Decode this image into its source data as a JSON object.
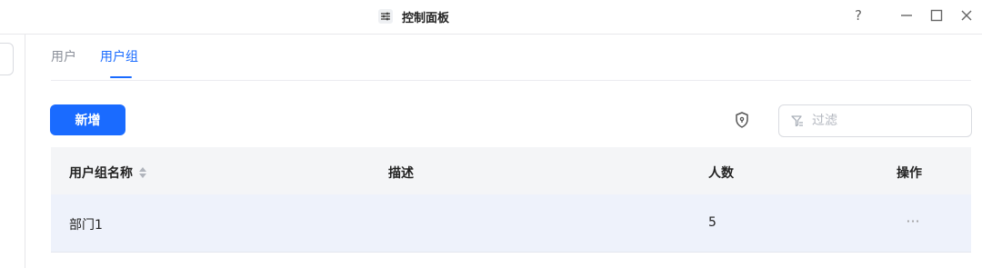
{
  "window": {
    "title": "控制面板",
    "help_label": "?",
    "minimize_label": "—",
    "close_label": "✕"
  },
  "tabs": [
    {
      "label": "用户",
      "active": false
    },
    {
      "label": "用户组",
      "active": true
    }
  ],
  "toolbar": {
    "add_label": "新增",
    "filter_placeholder": "过滤",
    "filter_value": ""
  },
  "table": {
    "columns": [
      "用户组名称",
      "描述",
      "人数",
      "操作"
    ],
    "rows": [
      {
        "name": "部门1",
        "description": "",
        "count": "5",
        "action": "···"
      }
    ]
  },
  "colors": {
    "accent": "#1a6bff",
    "header_bg": "#f4f5f7",
    "row_bg": "#eef2fb"
  }
}
